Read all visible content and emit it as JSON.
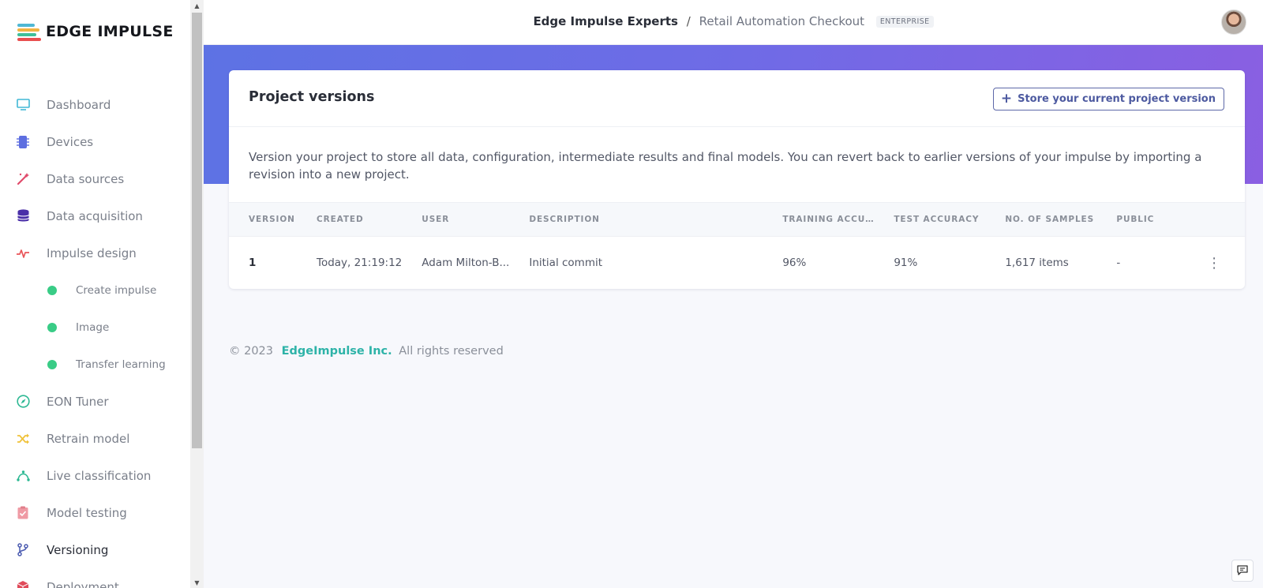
{
  "logo": {
    "text": "EDGE IMPULSE",
    "bar_colors": [
      "#4fb8d4",
      "#f2b441",
      "#3fbf9a",
      "#e94f4f"
    ]
  },
  "sidebar": {
    "items": [
      {
        "label": "Dashboard",
        "icon": "monitor-icon",
        "color": "#41b8d5",
        "type": "main"
      },
      {
        "label": "Devices",
        "icon": "chip-icon",
        "color": "#5d6ee0",
        "type": "main"
      },
      {
        "label": "Data sources",
        "icon": "wand-icon",
        "color": "#e04b6b",
        "type": "main"
      },
      {
        "label": "Data acquisition",
        "icon": "database-icon",
        "color": "#4a2fa8",
        "type": "main"
      },
      {
        "label": "Impulse design",
        "icon": "pulse-icon",
        "color": "#e9565a",
        "type": "main"
      },
      {
        "label": "Create impulse",
        "type": "sub"
      },
      {
        "label": "Image",
        "type": "sub"
      },
      {
        "label": "Transfer learning",
        "type": "sub"
      },
      {
        "label": "EON Tuner",
        "icon": "compass-icon",
        "color": "#2db893",
        "type": "main"
      },
      {
        "label": "Retrain model",
        "icon": "shuffle-icon",
        "color": "#f0c23b",
        "type": "main"
      },
      {
        "label": "Live classification",
        "icon": "bezier-icon",
        "color": "#2db893",
        "type": "main"
      },
      {
        "label": "Model testing",
        "icon": "clipboard-check-icon",
        "color": "#ef9aa4",
        "type": "main"
      },
      {
        "label": "Versioning",
        "icon": "git-branch-icon",
        "color": "#4a5ab0",
        "type": "main",
        "active": true
      },
      {
        "label": "Deployment",
        "icon": "cube-icon",
        "color": "#e04b5a",
        "type": "main"
      }
    ]
  },
  "header": {
    "org": "Edge Impulse Experts",
    "separator": "/",
    "project": "Retail Automation Checkout",
    "badge": "ENTERPRISE"
  },
  "card": {
    "title": "Project versions",
    "store_button": {
      "icon": "plus-icon",
      "label": "Store your current project version"
    },
    "description": "Version your project to store all data, configuration, intermediate results and final models. You can revert back to earlier versions of your impulse by importing a revision into a new project.",
    "columns": [
      "VERSION",
      "CREATED",
      "USER",
      "DESCRIPTION",
      "TRAINING ACCURA...",
      "TEST ACCURACY",
      "NO. OF SAMPLES",
      "PUBLIC"
    ],
    "rows": [
      {
        "version": "1",
        "created": "Today, 21:19:12",
        "user": "Adam Milton-B...",
        "description": "Initial commit",
        "training_accuracy": "96%",
        "test_accuracy": "91%",
        "samples": "1,617 items",
        "public": "-"
      }
    ]
  },
  "footer": {
    "copyright": "© 2023",
    "company": "EdgeImpulse Inc.",
    "rights": "All rights reserved"
  },
  "colors": {
    "banner_start": "#5d72e4",
    "banner_end": "#8a5fe2",
    "accent": "#4d5aa0",
    "brand_teal": "#2eb3a8",
    "sub_dot": "#39cc86"
  }
}
